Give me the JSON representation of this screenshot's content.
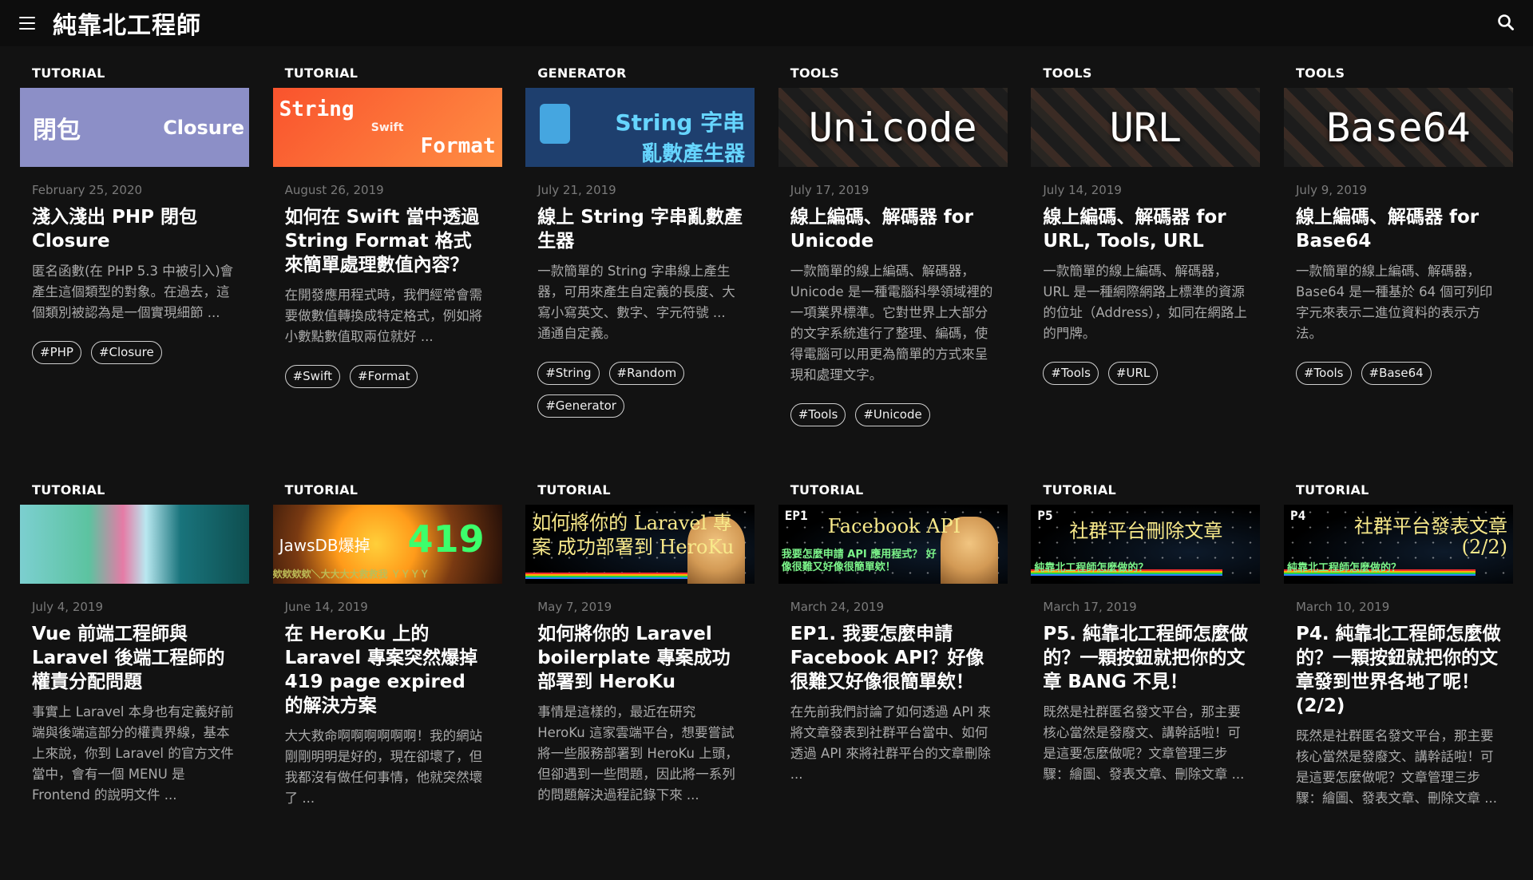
{
  "header": {
    "site_title": "純靠北工程師",
    "menu_icon": "hamburger-icon",
    "search_icon": "search-icon"
  },
  "posts": [
    {
      "category": "TUTORIAL",
      "thumb": {
        "left": "閉包",
        "right": "Closure"
      },
      "date": "February 25, 2020",
      "title": "淺入淺出 PHP 閉包 Closure",
      "excerpt": "匿名函數(在 PHP 5.3 中被引入)會產生這個類型的對象。在過去，這個類別被認為是一個實現細節 ...",
      "tags": [
        "#PHP",
        "#Closure"
      ]
    },
    {
      "category": "TUTORIAL",
      "thumb": {
        "top": "String",
        "mid": "Swift",
        "bottom": "Format"
      },
      "date": "August 26, 2019",
      "title": "如何在 Swift 當中透過 String Format 格式來簡單處理數值內容？",
      "excerpt": "在開發應用程式時，我們經常會需要做數值轉換成特定格式，例如將小數點數值取兩位就好 ...",
      "tags": [
        "#Swift",
        "#Format"
      ]
    },
    {
      "category": "GENERATOR",
      "thumb": {
        "line1": "String 字串",
        "line2": "亂數產生器"
      },
      "date": "July 21, 2019",
      "title": "線上 String 字串亂數產生器",
      "excerpt": "一款簡單的 String 字串線上產生器，可用來產生自定義的長度、大寫小寫英文、數字、字元符號 ... 通通自定義。",
      "tags": [
        "#String",
        "#Random",
        "#Generator"
      ]
    },
    {
      "category": "TOOLS",
      "thumb": {
        "text": "Unicode"
      },
      "date": "July 17, 2019",
      "title": "線上編碼、解碼器 for Unicode",
      "excerpt": "一款簡單的線上編碼、解碼器，Unicode 是一種電腦科學領域裡的一項業界標準。它對世界上大部分的文字系統進行了整理、編碼，使得電腦可以用更為簡單的方式來呈現和處理文字。",
      "tags": [
        "#Tools",
        "#Unicode"
      ]
    },
    {
      "category": "TOOLS",
      "thumb": {
        "text": "URL"
      },
      "date": "July 14, 2019",
      "title": "線上編碼、解碼器 for URL, Tools, URL",
      "excerpt": "一款簡單的線上編碼、解碼器，URL 是一種網際網路上標準的資源的位址（Address），如同在網路上的門牌。",
      "tags": [
        "#Tools",
        "#URL"
      ]
    },
    {
      "category": "TOOLS",
      "thumb": {
        "text": "Base64"
      },
      "date": "July 9, 2019",
      "title": "線上編碼、解碼器 for Base64",
      "excerpt": "一款簡單的線上編碼、解碼器，Base64 是一種基於 64 個可列印字元來表示二進位資料的表示方法。",
      "tags": [
        "#Tools",
        "#Base64"
      ]
    },
    {
      "category": "TUTORIAL",
      "thumb": {},
      "date": "July 4, 2019",
      "title": "Vue 前端工程師與 Laravel 後端工程師的權責分配問題",
      "excerpt": "事實上 Laravel 本身也有定義好前端與後端這部分的權責界線，基本上來說，你到 Laravel 的官方文件當中，會有一個 MENU 是 Frontend 的說明文件 ...",
      "tags": []
    },
    {
      "category": "TUTORIAL",
      "thumb": {
        "title": "JawsDB爆掉",
        "number": "419",
        "footer": "欸欸欸欸＼大大大大救救我 ＹＹＹＹ"
      },
      "date": "June 14, 2019",
      "title": "在 HeroKu 上的 Laravel 專案突然爆掉 419 page expired 的解決方案",
      "excerpt": "大大救命啊啊啊啊啊啊！我的網站剛剛明明是好的，現在卻壞了，但我都沒有做任何事情，他就突然壞了 ...",
      "tags": []
    },
    {
      "category": "TUTORIAL",
      "thumb": {
        "title": "如何將你的 Laravel 專案 成功部署到 HeroKu"
      },
      "date": "May 7, 2019",
      "title": "如何將你的 Laravel boilerplate 專案成功部署到 HeroKu",
      "excerpt": "事情是這樣的，最近在研究 HeroKu 這家雲端平台，想要嘗試將一些服務部署到 HeroKu 上頭，但卻遇到一些問題，因此將一系列的問題解決過程記錄下來 ...",
      "tags": []
    },
    {
      "category": "TUTORIAL",
      "thumb": {
        "label": "EP1",
        "title": "Facebook API",
        "subtitle": "我要怎麼申請 API 應用程式？ 好像很難又好像很簡單欸！"
      },
      "date": "March 24, 2019",
      "title": "EP1. 我要怎麼申請 Facebook API？好像很難又好像很簡單欸！",
      "excerpt": "在先前我們討論了如何透過 API 來將文章發表到社群平台當中、如何透過 API 來將社群平台的文章刪除 ...",
      "tags": []
    },
    {
      "category": "TUTORIAL",
      "thumb": {
        "label": "P5",
        "title": "社群平台刪除文章",
        "subtitle": "純靠北工程師怎麼做的？"
      },
      "date": "March 17, 2019",
      "title": "P5. 純靠北工程師怎麼做的？一顆按鈕就把你的文章 BANG 不見！",
      "excerpt": "既然是社群匿名發文平台，那主要核心當然是發廢文、講幹話啦！可是這要怎麼做呢？文章管理三步驟：繪圖、發表文章、刪除文章 ...",
      "tags": []
    },
    {
      "category": "TUTORIAL",
      "thumb": {
        "label": "P4",
        "title": "社群平台發表文章 (2/2)",
        "subtitle": "純靠北工程師怎麼做的？"
      },
      "date": "March 10, 2019",
      "title": "P4. 純靠北工程師怎麼做的？一顆按鈕就把你的文章發到世界各地了呢！(2/2)",
      "excerpt": "既然是社群匿名發文平台，那主要核心當然是發廢文、講幹話啦！可是這要怎麼做呢？文章管理三步驟：繪圖、發表文章、刪除文章 ...",
      "tags": []
    }
  ]
}
